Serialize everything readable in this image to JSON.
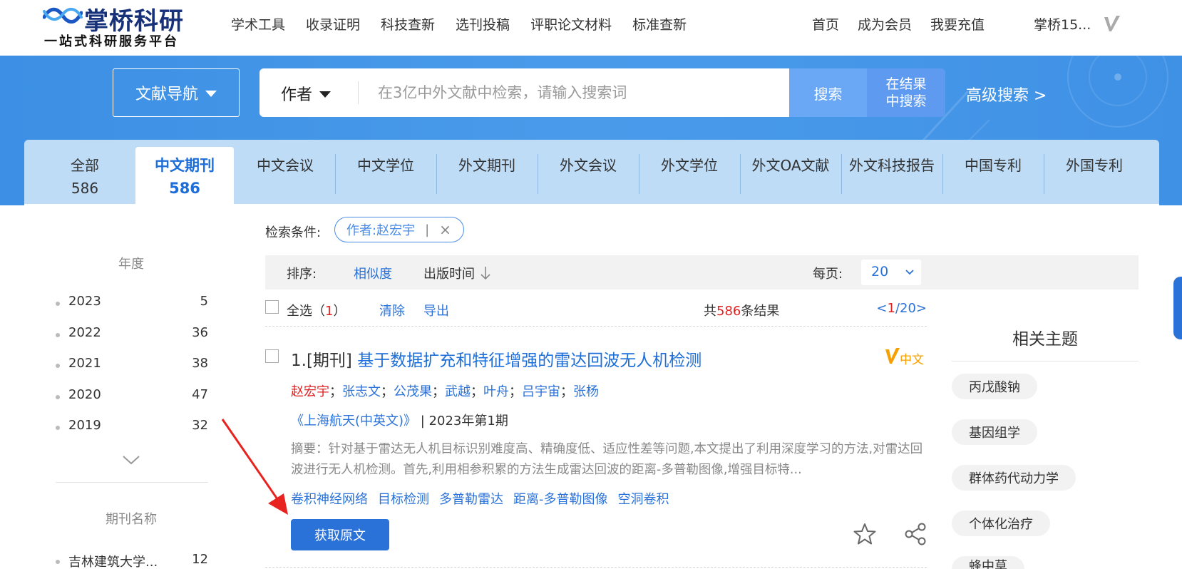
{
  "header": {
    "logo_title": "掌桥科研",
    "logo_sub": "一站式科研服务平台",
    "nav": [
      "学术工具",
      "收录证明",
      "科技查新",
      "选刊投稿",
      "评职论文材料",
      "标准查新"
    ],
    "right_nav": [
      "首页",
      "成为会员",
      "我要充值"
    ],
    "user": "掌桥15..."
  },
  "search": {
    "doc_nav_label": "文献导航",
    "field_type": "作者",
    "placeholder": "在3亿中外文献中检索，请输入搜索词",
    "search_button": "搜索",
    "within_button_l1": "在结果",
    "within_button_l2": "中搜索",
    "advanced": "高级搜索  >"
  },
  "tabs": [
    {
      "label": "全部",
      "count": "586"
    },
    {
      "label": "中文期刊",
      "count": "586"
    },
    {
      "label": "中文会议",
      "count": ""
    },
    {
      "label": "中文学位",
      "count": ""
    },
    {
      "label": "外文期刊",
      "count": ""
    },
    {
      "label": "外文会议",
      "count": ""
    },
    {
      "label": "外文学位",
      "count": ""
    },
    {
      "label": "外文OA文献",
      "count": ""
    },
    {
      "label": "外文科技报告",
      "count": ""
    },
    {
      "label": "中国专利",
      "count": ""
    },
    {
      "label": "外国专利",
      "count": ""
    }
  ],
  "facets": {
    "year_title": "年度",
    "years": [
      {
        "year": "2023",
        "count": "5"
      },
      {
        "year": "2022",
        "count": "36"
      },
      {
        "year": "2021",
        "count": "38"
      },
      {
        "year": "2020",
        "count": "47"
      },
      {
        "year": "2019",
        "count": "32"
      }
    ],
    "journal_title": "期刊名称",
    "journals": [
      {
        "name": "吉林建筑大学...",
        "count": "12"
      }
    ]
  },
  "conditions": {
    "label": "检索条件:",
    "tag": "作者:赵宏宇",
    "tag_bar": "|",
    "tag_close": "×"
  },
  "sort": {
    "label": "排序:",
    "relevance": "相似度",
    "date": "出版时间",
    "per_page_label": "每页:",
    "per_page": "20"
  },
  "selection": {
    "select_all": "全选（",
    "selected_count": "1",
    "select_all_close": "）",
    "clear": "清除",
    "export": "导出",
    "total_prefix": "共",
    "total": "586",
    "total_suffix": "条结果",
    "pager_prefix": "<",
    "page": "1",
    "pager_suffix": "/20>"
  },
  "result": {
    "prefix": "1.[期刊] ",
    "title": "基于数据扩充和特征增强的雷达回波无人机检测",
    "badge": "中文",
    "authors": [
      "赵宏宇",
      "张志文",
      "公茂果",
      "武越",
      "叶舟",
      "吕宇宙",
      "张杨"
    ],
    "author_sep": "；",
    "journal": "《上海航天(中英文)》",
    "issue": " | 2023年第1期",
    "abstract": "摘要：针对基于雷达无人机目标识别难度高、精确度低、适应性差等问题,本文提出了利用深度学习的方法,对雷达回波进行无人机检测。首先,利用相参积累的方法生成雷达回波的距离-多普勒图像,增强目标特...",
    "keywords": [
      "卷积神经网络",
      "目标检测",
      "多普勒雷达",
      "距离-多普勒图像",
      "空洞卷积"
    ],
    "get_button": "获取原文"
  },
  "topics": {
    "title": "相关主题",
    "items": [
      "丙戊酸钠",
      "基因组学",
      "群体药代动力学",
      "个体化治疗",
      "蜂中草"
    ]
  },
  "colors": {
    "brand_blue": "#2b72d8",
    "band_blue": "#4a9bea",
    "highlight_red": "#e02222"
  }
}
